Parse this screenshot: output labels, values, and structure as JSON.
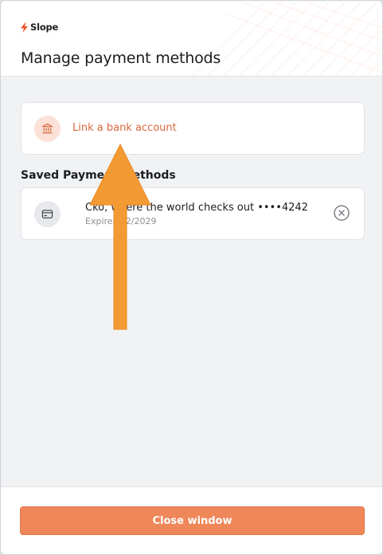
{
  "brand": {
    "name": "Slope",
    "color": "#e8562a"
  },
  "page": {
    "title": "Manage payment methods"
  },
  "link_bank": {
    "label": "Link a bank account",
    "icon": "bank-icon"
  },
  "saved": {
    "title": "Saved Payment Methods",
    "items": [
      {
        "name": "Cko, where the world checks out ••••4242",
        "expiry": "Expires 12/2029",
        "icon": "credit-card-icon",
        "remove_icon": "close-circle-icon"
      }
    ]
  },
  "footer": {
    "close_label": "Close window"
  },
  "annotation": {
    "icon": "orange-arrow-up",
    "color": "#f39a34"
  },
  "colors": {
    "accent": "#d8663b",
    "button": "#ef8759",
    "background": "#f1f2f4"
  }
}
